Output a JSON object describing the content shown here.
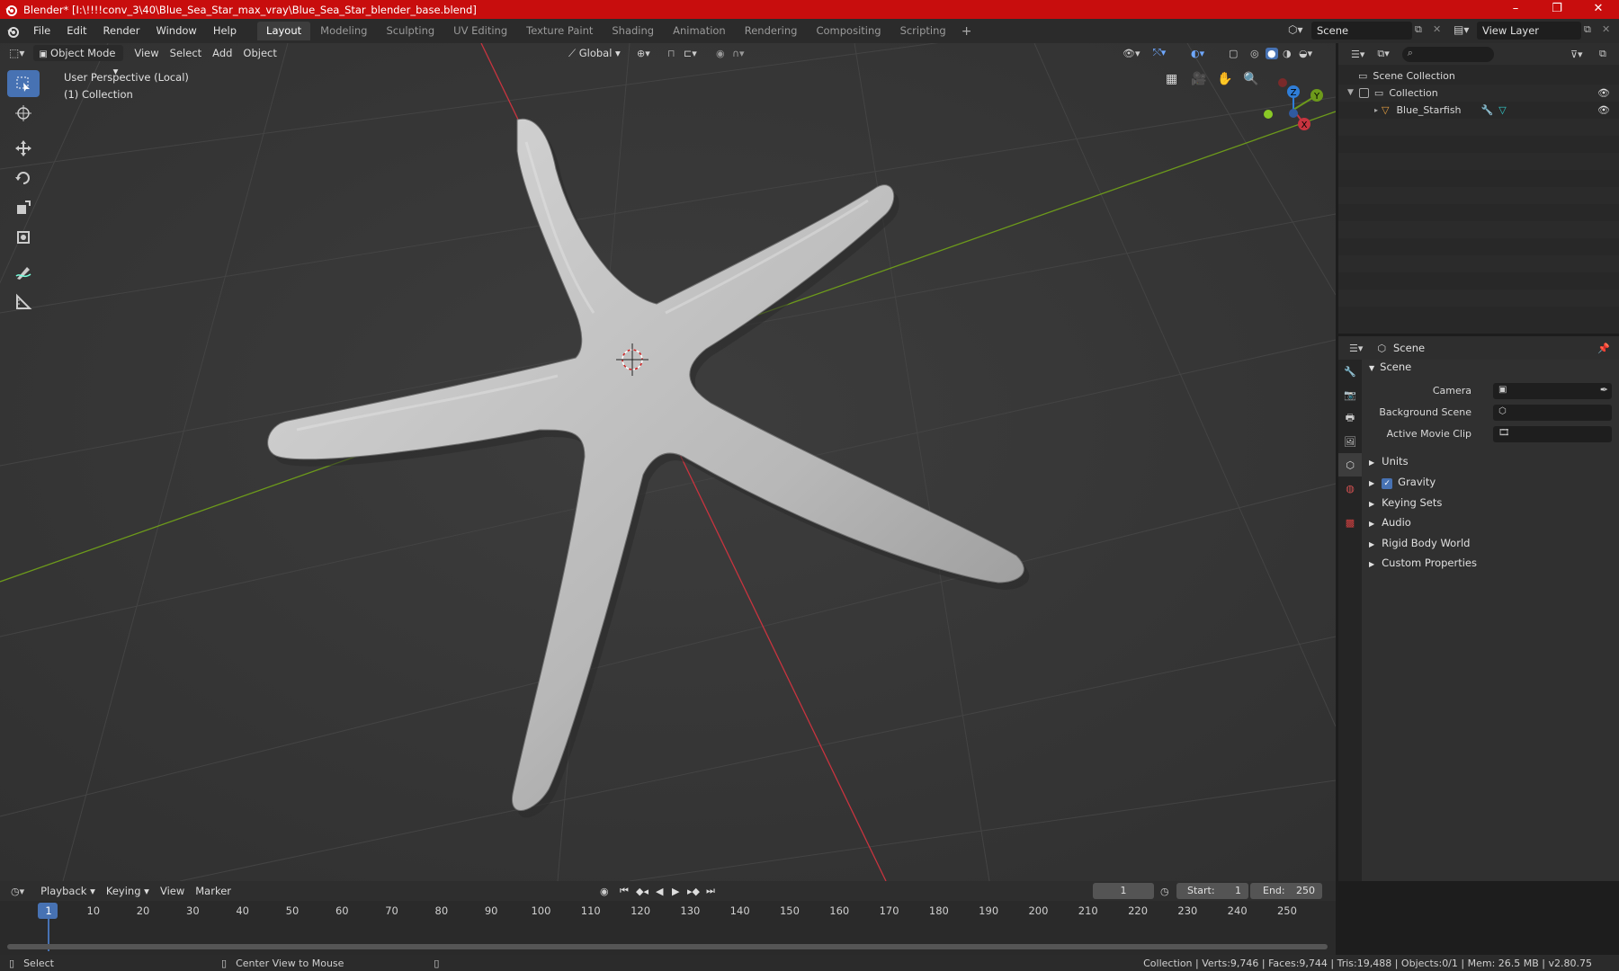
{
  "window": {
    "title": "Blender* [I:\\!!!!conv_3\\40\\Blue_Sea_Star_max_vray\\Blue_Sea_Star_blender_base.blend]",
    "controls": [
      "–",
      "❐",
      "✕"
    ]
  },
  "menu": [
    "File",
    "Edit",
    "Render",
    "Window",
    "Help"
  ],
  "workspaces": [
    "Layout",
    "Modeling",
    "Sculpting",
    "UV Editing",
    "Texture Paint",
    "Shading",
    "Animation",
    "Rendering",
    "Compositing",
    "Scripting"
  ],
  "active_workspace": "Layout",
  "scene_name": "Scene",
  "view_layer": "View Layer",
  "viewport": {
    "mode": "Object Mode",
    "menus": [
      "View",
      "Select",
      "Add",
      "Object"
    ],
    "orientation": "Global",
    "info_line1": "User Perspective (Local)",
    "info_line2": "(1) Collection",
    "gizmo": {
      "x": "X",
      "y": "Y",
      "z": "Z"
    }
  },
  "outliner": {
    "root": "Scene Collection",
    "collection": "Collection",
    "object": "Blue_Starfish"
  },
  "properties": {
    "header": "Scene",
    "panel": "Scene",
    "fields": {
      "camera": "Camera",
      "background_scene": "Background Scene",
      "active_movie_clip": "Active Movie Clip"
    },
    "sections": [
      "Units",
      "Gravity",
      "Keying Sets",
      "Audio",
      "Rigid Body World",
      "Custom Properties"
    ],
    "gravity_enabled": true
  },
  "timeline": {
    "menus": [
      "Playback",
      "Keying",
      "View",
      "Marker"
    ],
    "current_frame": "1",
    "start_label": "Start:",
    "start": "1",
    "end_label": "End:",
    "end": "250",
    "ruler": [
      "1",
      "10",
      "20",
      "30",
      "40",
      "50",
      "60",
      "70",
      "80",
      "90",
      "100",
      "110",
      "120",
      "130",
      "140",
      "150",
      "160",
      "170",
      "180",
      "190",
      "200",
      "210",
      "220",
      "230",
      "240",
      "250"
    ]
  },
  "status": {
    "left": "Select",
    "middle": "Center View to Mouse",
    "right": "Collection | Verts:9,746 | Faces:9,744 | Tris:19,488 | Objects:0/1 | Mem: 26.5 MB | v2.80.75"
  },
  "colors": {
    "titlebar": "#c80d0d",
    "accent": "#4772b3",
    "x_axis": "#c8343f",
    "y_axis": "#6d9a1b",
    "z_axis": "#2f7ed8"
  }
}
